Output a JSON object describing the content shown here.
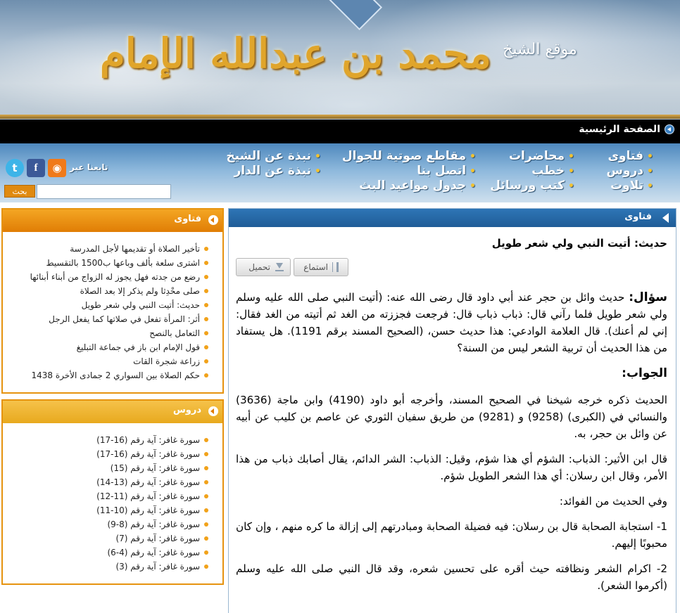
{
  "banner": {
    "calligraphy": "محمد بن عبدالله الإمام",
    "site_label": "موقع الشيخ"
  },
  "homebar": {
    "home_label": "الصفحة الرئيسية"
  },
  "nav": {
    "col1": [
      "فتاوى",
      "دروس",
      "تلاوت"
    ],
    "col2": [
      "محاضرات",
      "خطب",
      "كتب ورسائل"
    ],
    "col3": [
      "مقاطع صوتية للجوال",
      "اتصل بنا",
      "جدول مواعيد البث"
    ],
    "col4": [
      "نبذة عن الشيخ",
      "نبذة عن الدار"
    ]
  },
  "social": {
    "follow_label": "تابعنا عبر",
    "twitter": "t",
    "facebook": "f",
    "rss": "◉"
  },
  "search": {
    "button": "بحث",
    "value": ""
  },
  "fatawa_box": {
    "title": "فتاوى",
    "items": [
      "تأخير الصلاة أو تقديمها لأجل المدرسة",
      "اشترى سلعة بألف وباعها ب1500 بالتقسيط",
      "رضع من جدته فهل يجوز له الزواج من أبناء أبنائها",
      "صلى محْدِثا ولم يذكر إلا بعد الصلاة",
      "حديث: أتيت النبي ولي شعر طويل",
      "أثر: المرأة تفعل في صلاتها كما يفعل الرجل",
      "التعامل بالنصح",
      "قول الإمام ابن باز في جماعة التبليغ",
      "زراعة شجرة القات",
      "حكم الصلاة بين السواري 2 جمادى الأخرة 1438"
    ]
  },
  "durus_box": {
    "title": "دروس",
    "items": [
      "سورة غافر: آية رقم (16-17)",
      "سورة غافر: آية رقم (16-17)",
      "سورة غافر: آية رقم (15)",
      "سورة غافر: آية رقم (13-14)",
      "سورة غافر: آية رقم (11-12)",
      "سورة غافر: آية رقم (10-11)",
      "سورة غافر: آية رقم (8-9)",
      "سورة غافر: آية رقم (7)",
      "سورة غافر: آية رقم (4-6)",
      "سورة غافر: آية رقم (3)"
    ]
  },
  "main": {
    "section_title": "فتاوى",
    "question_title": "حديث: أتيت النبي ولي شعر طويل",
    "listen_label": "استماع",
    "download_label": "تحميل",
    "question_label": "سؤال:",
    "question_text": "حديث وائل بن حجر عند أبي داود قال رضى الله عنه: (أتيت النبي صلى الله عليه وسلم ولي شعر طويل فلما رآني قال: ذباب ذباب قال: فرجعت فجززته من الغد ثم أتيته من الغد فقال: إني لم أعنك). قال العلامة الوادعي: هذا حديث حسن، (الصحيح المسند برقم 1191). هل يستفاد من هذا الحديث أن تربية الشعر ليس من السنة؟",
    "answer_heading": "الجواب:",
    "paragraphs": [
      "الحديث ذكره خرجه شيخنا في الصحيح المسند، وأخرجه أبو داود (4190) وابن ماجة (3636) والنسائي في (الكبرى) (9258) و (9281) من طريق سفيان الثوري عن عاصم بن كليب عن أبيه عن وائل بن حجر، به.",
      "قال ابن الأثير: الذباب: الشؤم أي هذا شؤم، وقيل: الذباب: الشر الدائم، يقال أصابك ذباب من هذا الأمر، وقال ابن رسلان: أي هذا الشعر الطويل شؤم.",
      "وفي الحديث من الفوائد:",
      "1- استجابة الصحابة قال بن رسلان: فيه فضيلة الصحابة ومبادرتهم إلى إزالة ما كره منهم ، وإن كان محبوبًا إليهم.",
      "2- اكرام الشعر ونظافته حيث أقره على تحسين شعره، وقد قال النبي صلى الله عليه وسلم (أكرموا الشعر)."
    ]
  }
}
